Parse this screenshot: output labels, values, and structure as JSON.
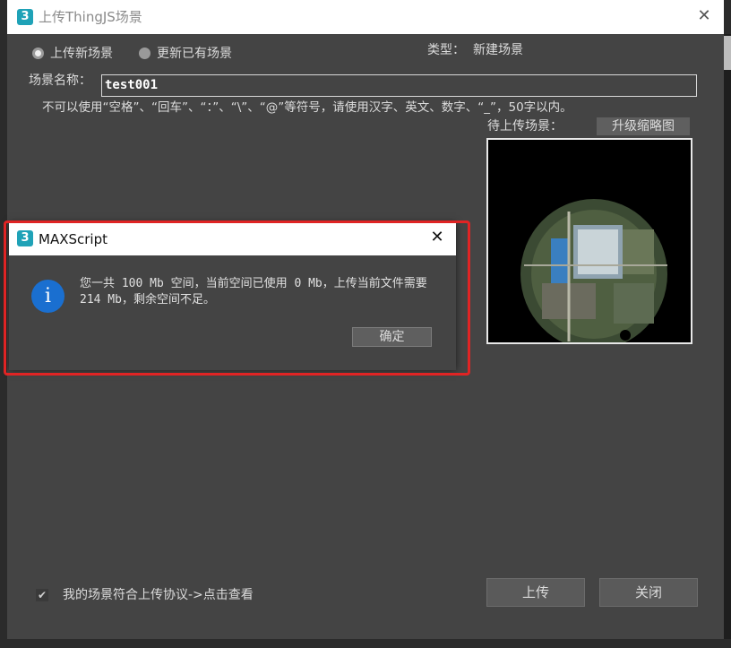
{
  "window": {
    "title": "上传ThingJS场景",
    "icon_glyph": "3",
    "close_glyph": "✕"
  },
  "form": {
    "radio_new_label": "上传新场景",
    "radio_update_label": "更新已有场景",
    "selected_mode": "upload-new",
    "type_label": "类型：",
    "type_value": "新建场景",
    "scene_name_label": "场景名称：",
    "scene_name_value": "test001",
    "rule_text": "不可以使用“空格”、“回车”、“：”、“\\”、“@”等符号，请使用汉字、英文、数字、“_”，50字以内。",
    "pending_label": "待上传场景：",
    "upgrade_thumb_label": "升级缩略图",
    "agreement_label": "我的场景符合上传协议->点击查看",
    "agreement_checked": true,
    "upload_label": "上传",
    "close_label": "关闭"
  },
  "dialog": {
    "title": "MAXScript",
    "close_glyph": "✕",
    "icon_glyph": "i",
    "message": "您一共 100 Mb 空间，当前空间已使用 0 Mb，上传当前文件需要 214 Mb，剩余空间不足。",
    "ok_label": "确定"
  },
  "colors": {
    "accent_icon": "#1fa2b7",
    "info_icon": "#1a6fd0",
    "highlight": "#e02424",
    "window_bg": "#444444"
  }
}
